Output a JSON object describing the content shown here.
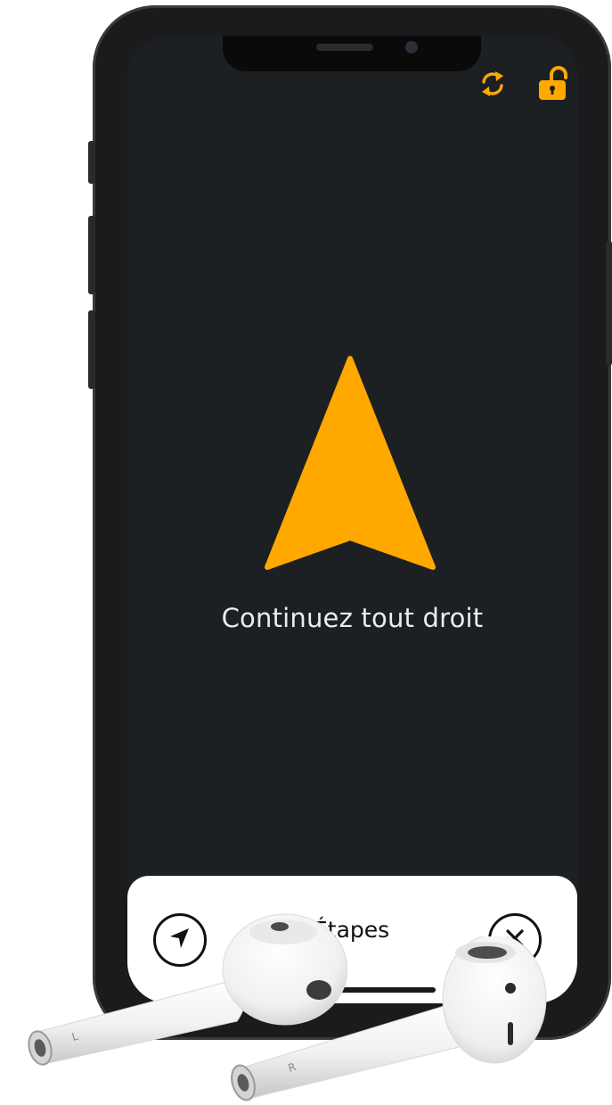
{
  "screen": {
    "instruction": "Continuez tout droit",
    "direction_icon": "arrow-up-icon",
    "accent_color": "#FFA800",
    "background_color": "#1C2023"
  },
  "top_bar": {
    "icons": [
      "refresh-icon",
      "unlock-icon"
    ]
  },
  "bottom_panel": {
    "left_button_icon": "location-arrow-icon",
    "steps_label": "Étapes",
    "steps_icon": "chevron-right-icon",
    "close_button_icon": "close-icon"
  },
  "earbuds": {
    "left_label": "L",
    "right_label": "R"
  }
}
